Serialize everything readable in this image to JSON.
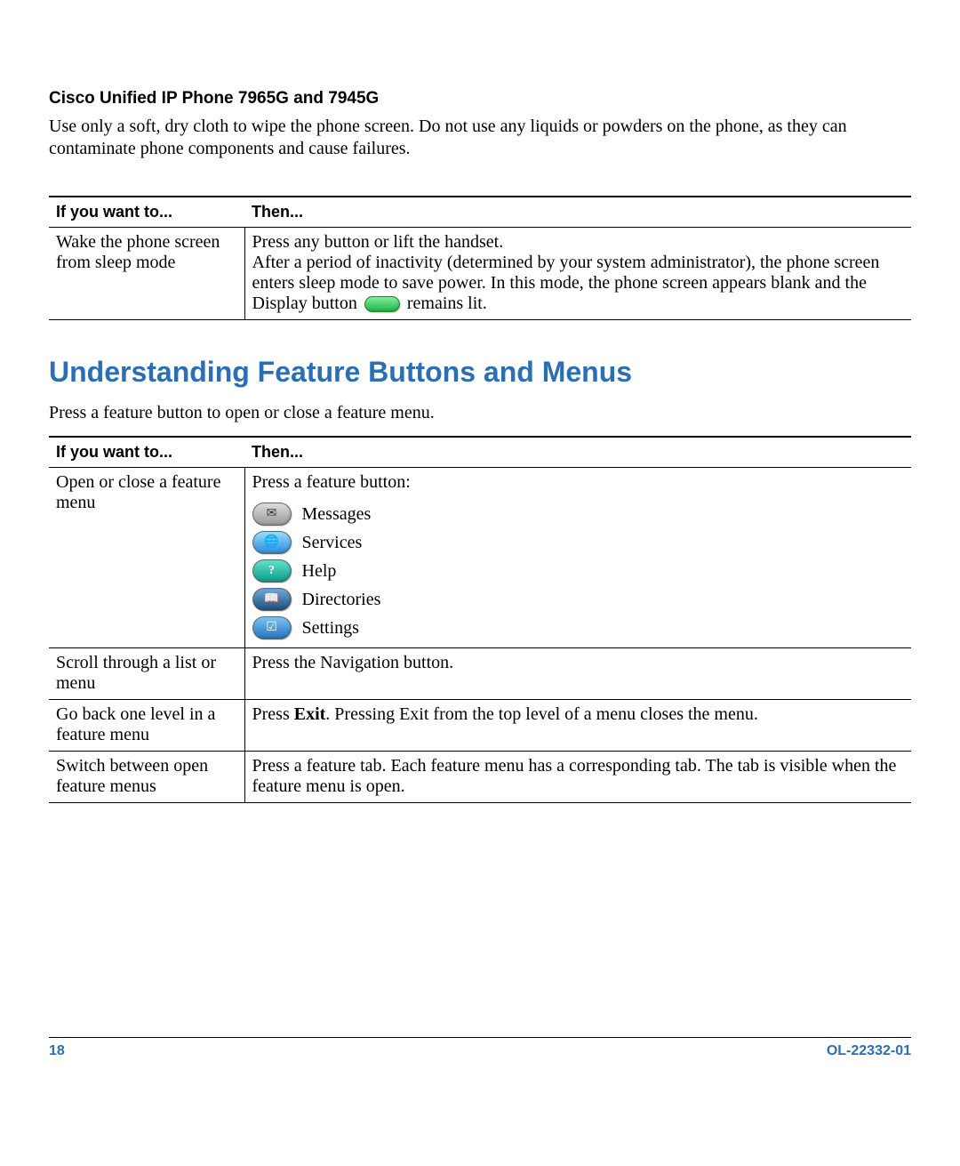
{
  "section1": {
    "heading": "Cisco Unified IP Phone 7965G and 7945G",
    "paragraph": "Use only a soft, dry cloth to wipe the phone screen. Do not use any liquids or powders on the phone, as they can contaminate phone components and cause failures."
  },
  "table1": {
    "header_left": "If you want to...",
    "header_right": "Then...",
    "row1_left": "Wake the phone screen from sleep mode",
    "row1_r1": "Press any button or lift the handset.",
    "row1_r2a": "After a period of inactivity (determined by your system administrator), the phone screen enters sleep mode to save power. In this mode, the phone screen appears blank and the Display button ",
    "row1_r2b": " remains lit."
  },
  "section2": {
    "heading": "Understanding Feature Buttons and Menus",
    "intro": "Press a feature button to open or close a feature menu."
  },
  "table2": {
    "header_left": "If you want to...",
    "header_right": "Then...",
    "r1_left": "Open or close a feature menu",
    "r1_intro": "Press a feature button:",
    "features": {
      "messages": "Messages",
      "services": "Services",
      "help": "Help",
      "directories": "Directories",
      "settings": "Settings"
    },
    "r2_left": "Scroll through a list or menu",
    "r2_right": "Press the Navigation button.",
    "r3_left": "Go back one level in a feature menu",
    "r3_pre": "Press ",
    "r3_bold": "Exit",
    "r3_post": ". Pressing Exit from the top level of a menu closes the menu.",
    "r4_left": "Switch between open feature menus",
    "r4_right": "Press a feature tab. Each feature menu has a corresponding tab. The tab is visible when the feature menu is open."
  },
  "footer": {
    "page": "18",
    "doc": "OL-22332-01"
  }
}
